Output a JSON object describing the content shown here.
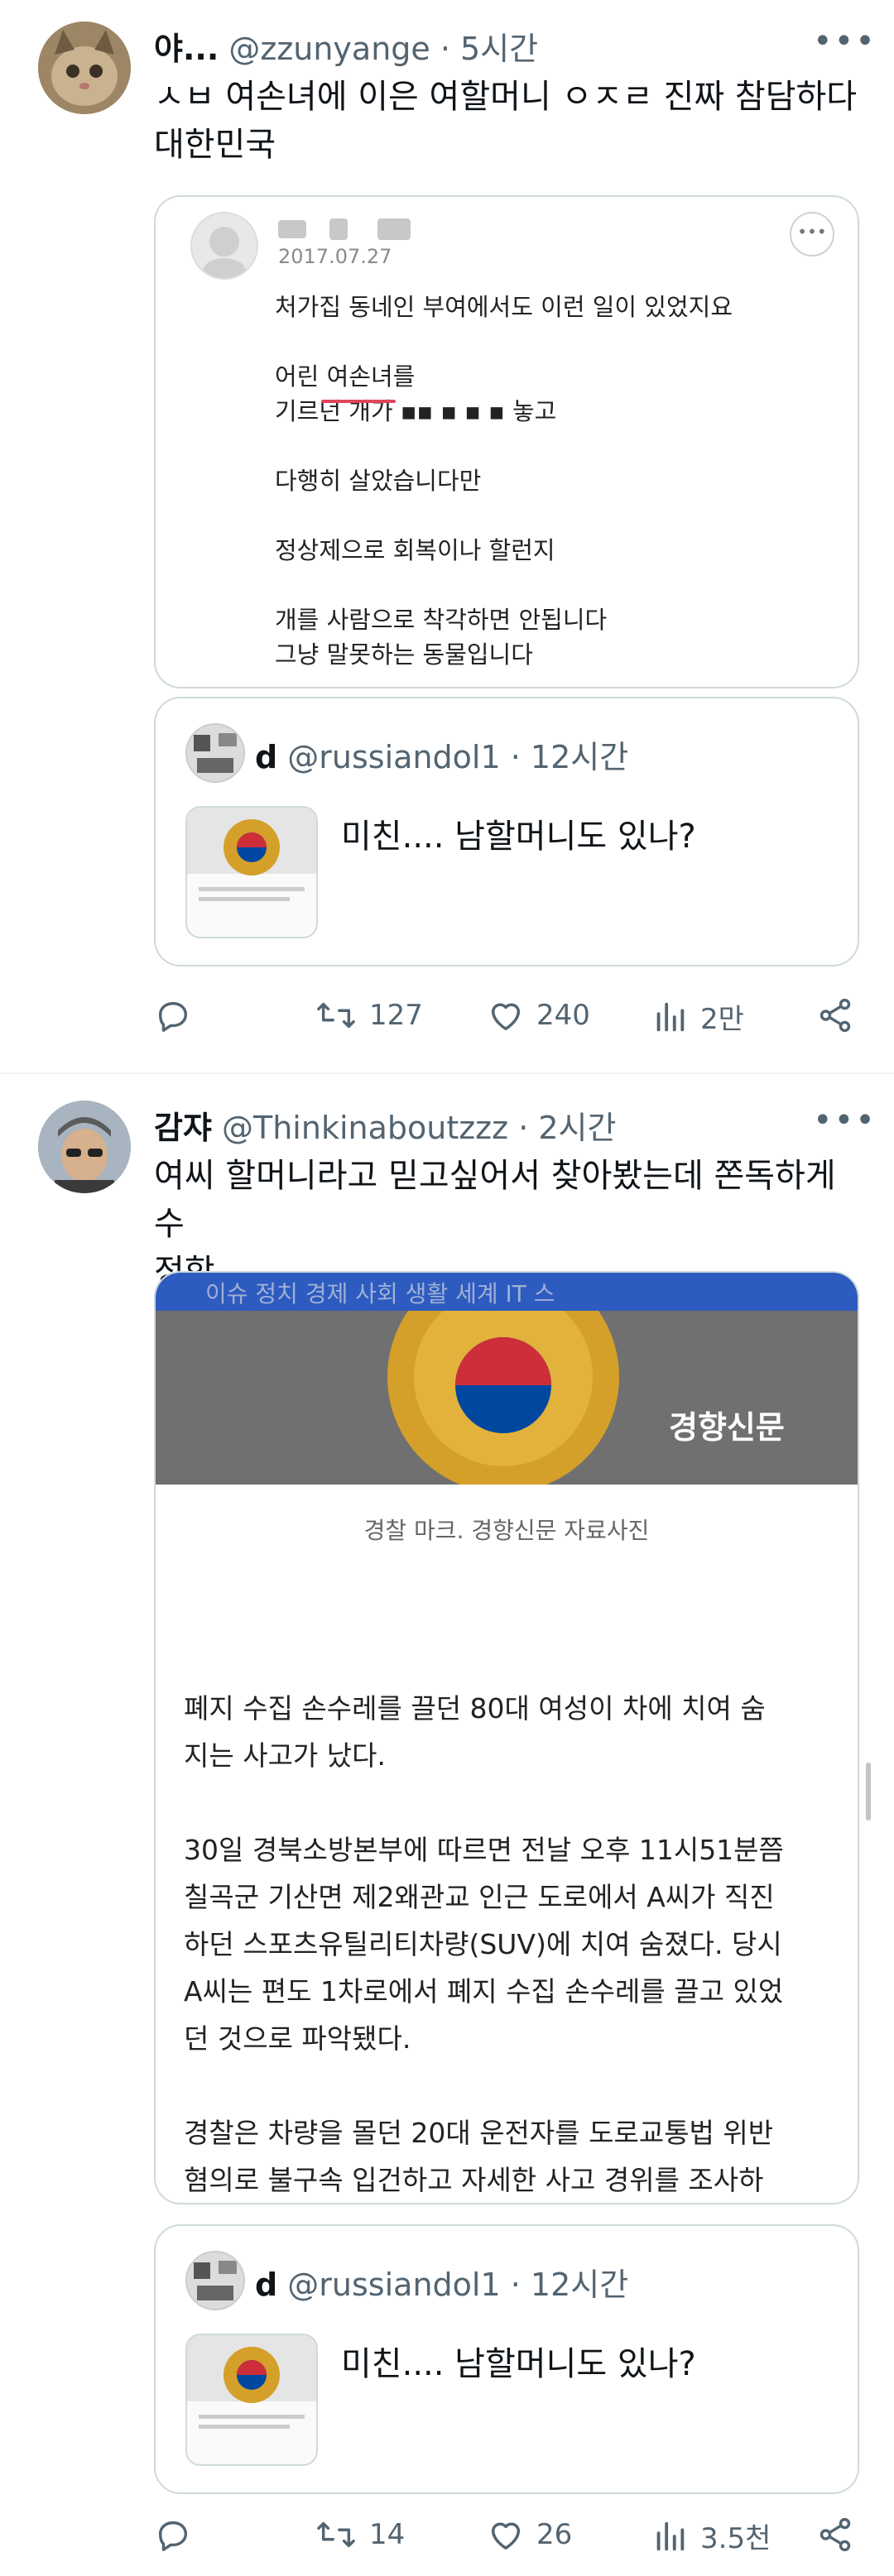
{
  "post1": {
    "display_name": "야...",
    "handle": "@zzunyange",
    "time": "· 5시간",
    "text": "ㅅㅂ 여손녀에 이은 여할머니 ㅇㅈㄹ 진짜 참담하다\n대한민국",
    "screenshot": {
      "date": "2017.07.27",
      "lines": "처가집 동네인 부여에서도 이런 일이 있었지요\n\n어린 여손녀를\n기르던 개가 ▪▪  ▪  ▪  ▪  놓고\n\n다행히 살았습니다만\n\n정상제으로 회복이나  할런지\n\n개를 사람으로  착각하면 안됩니다\n그냥 말못하는 동물입니다"
    },
    "quote": {
      "display_name": "d",
      "handle": "@russiandol1",
      "time": "· 12시간",
      "text": "미친.... 남할머니도 있나?"
    },
    "actions": {
      "reply": "",
      "retweet": "127",
      "like": "240",
      "views": "2만"
    }
  },
  "post2": {
    "display_name": "감쟈",
    "handle": "@Thinkinaboutzzz",
    "time": "· 2시간",
    "text": "여씨 할머니라고 믿고싶어서 찾아봤는데 쫀독하게 수\n정함",
    "article": {
      "nav": "이슈      정치      경제      사회      생활      세계      IT      스",
      "watermark": "경향신문",
      "caption": "경찰 마크. 경향신문 자료사진",
      "body": "폐지 수집 손수레를 끌던 80대 여성이 차에 치여 숨\n지는 사고가 났다.\n\n30일 경북소방본부에 따르면 전날 오후 11시51분쯤\n칠곡군 기산면 제2왜관교 인근 도로에서 A씨가 직진\n하던 스포츠유틸리티차량(SUV)에 치여 숨졌다. 당시\nA씨는 편도 1차로에서 폐지 수집 손수레를 끌고 있었\n던 것으로 파악됐다.\n\n경찰은 차량을 몰던 20대 운전자를 도로교통법 위반\n혐의로 불구속 입건하고 자세한 사고 경위를 조사하"
    },
    "quote": {
      "display_name": "d",
      "handle": "@russiandol1",
      "time": "· 12시간",
      "text": "미친.... 남할머니도 있나?"
    },
    "actions": {
      "reply": "",
      "retweet": "14",
      "like": "26",
      "views": "3.5천"
    }
  },
  "colors": {
    "text": "#0f1419",
    "secondary": "#536471",
    "border": "#cfd9de",
    "emblem_gold": "#d4a02a",
    "taeguk_red": "#cd2e3a",
    "taeguk_blue": "#0047a0",
    "underline_red": "#e0455a",
    "news_nav_bg": "#2d5bbf"
  },
  "icons": [
    "more-icon",
    "reply-icon",
    "retweet-icon",
    "like-icon",
    "views-icon",
    "share-icon"
  ]
}
